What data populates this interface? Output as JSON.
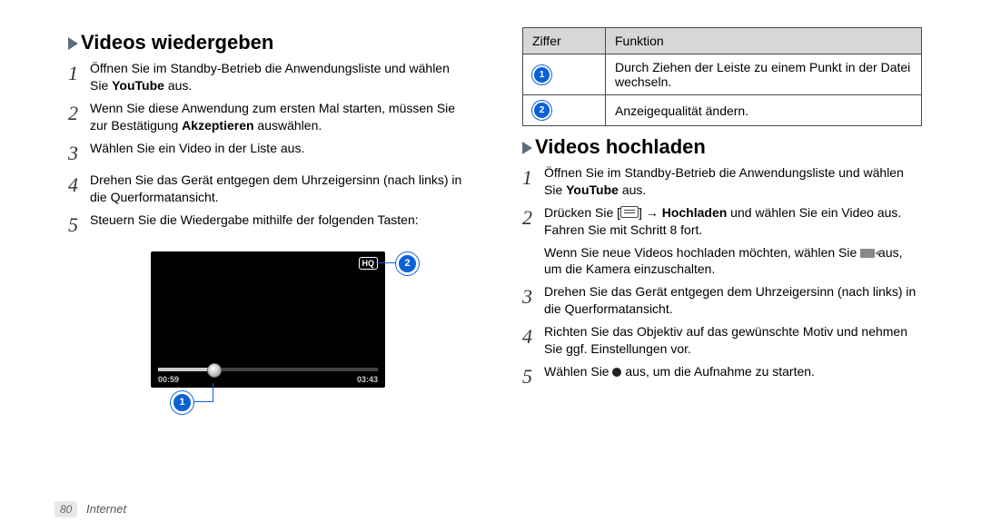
{
  "left": {
    "heading": "Videos wiedergeben",
    "steps": [
      {
        "num": "1",
        "pre": "Öffnen Sie im Standby-Betrieb die Anwendungsliste und wählen Sie ",
        "bold": "YouTube",
        "post": " aus."
      },
      {
        "num": "2",
        "pre": "Wenn Sie diese Anwendung zum ersten Mal starten, müssen Sie zur Bestätigung ",
        "bold": "Akzeptieren",
        "post": " auswählen."
      },
      {
        "num": "3",
        "pre": "Wählen Sie ein Video in der Liste aus.",
        "bold": "",
        "post": ""
      },
      {
        "num": "4",
        "pre": "Drehen Sie das Gerät entgegen dem Uhrzeigersinn (nach links) in die Querformatansicht.",
        "bold": "",
        "post": ""
      },
      {
        "num": "5",
        "pre": "Steuern Sie die Wiedergabe mithilfe der folgenden Tasten:",
        "bold": "",
        "post": ""
      }
    ],
    "video": {
      "hq": "HQ",
      "elapsed": "00:59",
      "total": "03:43"
    }
  },
  "right": {
    "table": {
      "h1": "Ziffer",
      "h2": "Funktion",
      "rows": [
        {
          "n": "1",
          "txt": "Durch Ziehen der Leiste zu einem Punkt in der Datei wechseln."
        },
        {
          "n": "2",
          "txt": "Anzeigequalität ändern."
        }
      ]
    },
    "heading": "Videos hochladen",
    "steps": [
      {
        "num": "1",
        "pre": "Öffnen Sie im Standby-Betrieb die Anwendungsliste und wählen Sie ",
        "bold": "YouTube",
        "post": " aus."
      },
      {
        "num": "2",
        "compose": true
      },
      {
        "num": "3",
        "pre": "Drehen Sie das Gerät entgegen dem Uhrzeigersinn (nach links) in die Querformatansicht.",
        "bold": "",
        "post": ""
      },
      {
        "num": "4",
        "pre": "Richten Sie das Objektiv auf das gewünschte Motiv und nehmen Sie ggf. Einstellungen vor.",
        "bold": "",
        "post": ""
      },
      {
        "num": "5",
        "compose_rec": true
      }
    ],
    "s2": {
      "a": "Drücken Sie [",
      "b": "] → ",
      "bold": "Hochladen",
      "c": " und wählen Sie ein Video aus. Fahren Sie mit Schritt 8 fort.",
      "note_a": "Wenn Sie neue Videos hochladen möchten, wählen Sie ",
      "note_b": " aus, um die Kamera einzuschalten."
    },
    "s5": {
      "a": "Wählen Sie ",
      "b": " aus, um die Aufnahme zu starten."
    }
  },
  "footer": {
    "page": "80",
    "section": "Internet"
  }
}
